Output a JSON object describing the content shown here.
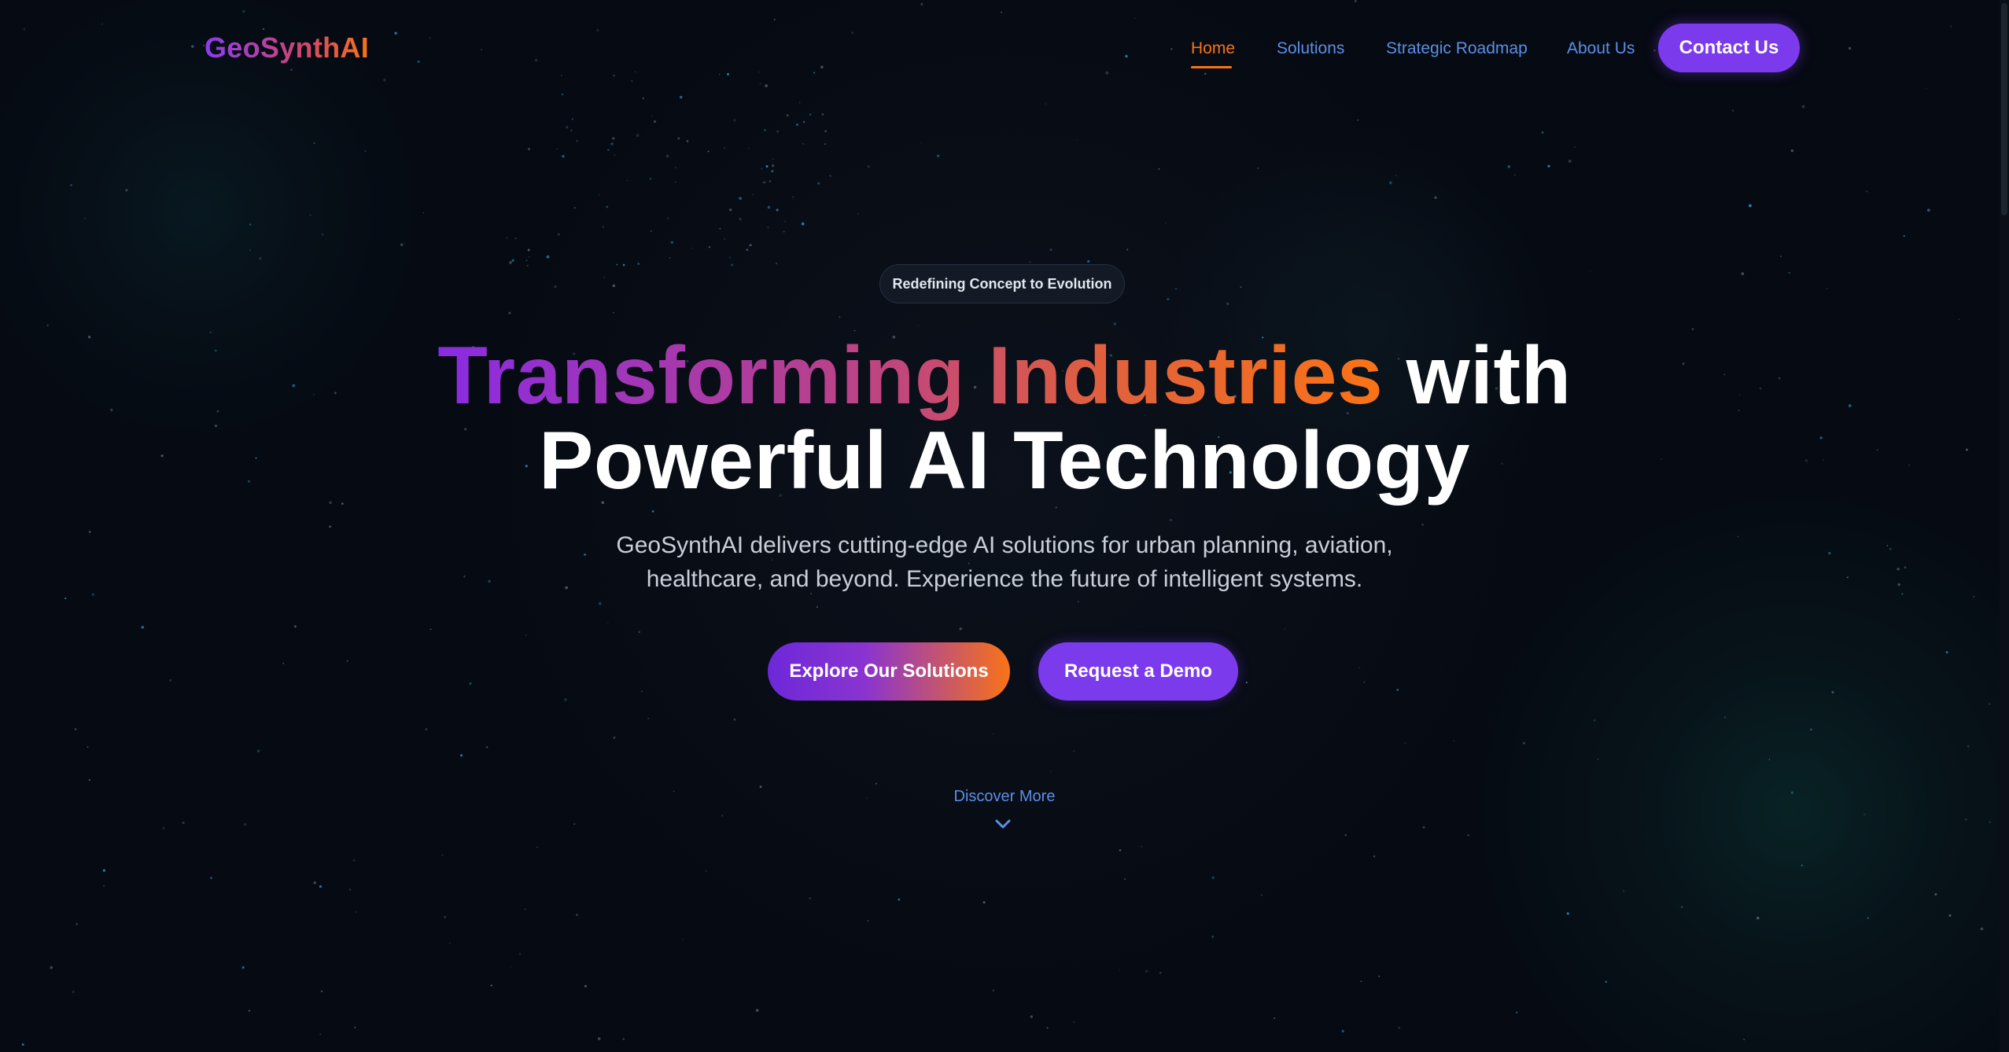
{
  "brand": {
    "logo_text": "GeoSynthAI"
  },
  "nav": {
    "items": [
      {
        "label": "Home",
        "active": true
      },
      {
        "label": "Solutions",
        "active": false
      },
      {
        "label": "Strategic Roadmap",
        "active": false
      },
      {
        "label": "About Us",
        "active": false
      }
    ],
    "contact_label": "Contact Us"
  },
  "hero": {
    "badge": "Redefining Concept to Evolution",
    "headline_gradient": "Transforming Industries",
    "headline_rest_line1": " with",
    "headline_line2": "Powerful AI Technology",
    "subtitle_line1": "GeoSynthAI delivers cutting-edge AI solutions for urban planning, aviation,",
    "subtitle_line2": "healthcare, and beyond. Experience the future of intelligent systems.",
    "primary_button": "Explore Our Solutions",
    "secondary_button": "Request a Demo",
    "discover_label": "Discover More",
    "discover_icon": "chevron-down-icon"
  },
  "colors": {
    "background": "#060a12",
    "accent_purple": "#7c3aed",
    "accent_orange": "#f97316",
    "link_blue": "#5b8fe6"
  }
}
